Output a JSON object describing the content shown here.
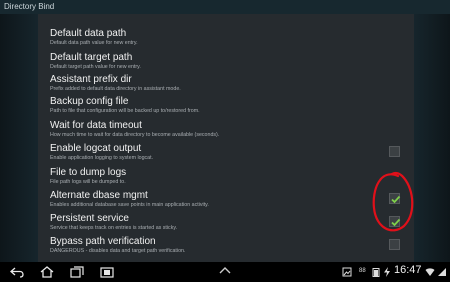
{
  "window": {
    "title": "Directory Bind"
  },
  "settings": [
    {
      "title": "Default data path",
      "summary": "Default data path value for new entry.",
      "checkbox": null
    },
    {
      "title": "Default target path",
      "summary": "Default target path value for new entry.",
      "checkbox": null
    },
    {
      "title": "Assistant prefix dir",
      "summary": "Prefix added to default data directory in assistant mode.",
      "checkbox": null
    },
    {
      "title": "Backup config file",
      "summary": "Path to file that configuration will be backed up to/restored from.",
      "checkbox": null
    },
    {
      "title": "Wait for data timeout",
      "summary": "How much time to wait for data directory to become available (seconds).",
      "checkbox": null
    },
    {
      "title": "Enable logcat output",
      "summary": "Enable application logging to system logcat.",
      "checkbox": false
    },
    {
      "title": "File to dump logs",
      "summary": "File path logs will be dumped to.",
      "checkbox": null
    },
    {
      "title": "Alternate dbase mgmt",
      "summary": "Enables additional database save points in main application activity.",
      "checkbox": true
    },
    {
      "title": "Persistent service",
      "summary": "Service that keeps track on entries is started as sticky.",
      "checkbox": true
    },
    {
      "title": "Bypass path verification",
      "summary": "DANGEROUS - disables data and target path verification.",
      "checkbox": false
    }
  ],
  "statusbar": {
    "time": "16:47",
    "battery_level": "88"
  },
  "colors": {
    "check": "#7fd04a",
    "annotation": "#e0101a",
    "panel": "#262b2f"
  }
}
